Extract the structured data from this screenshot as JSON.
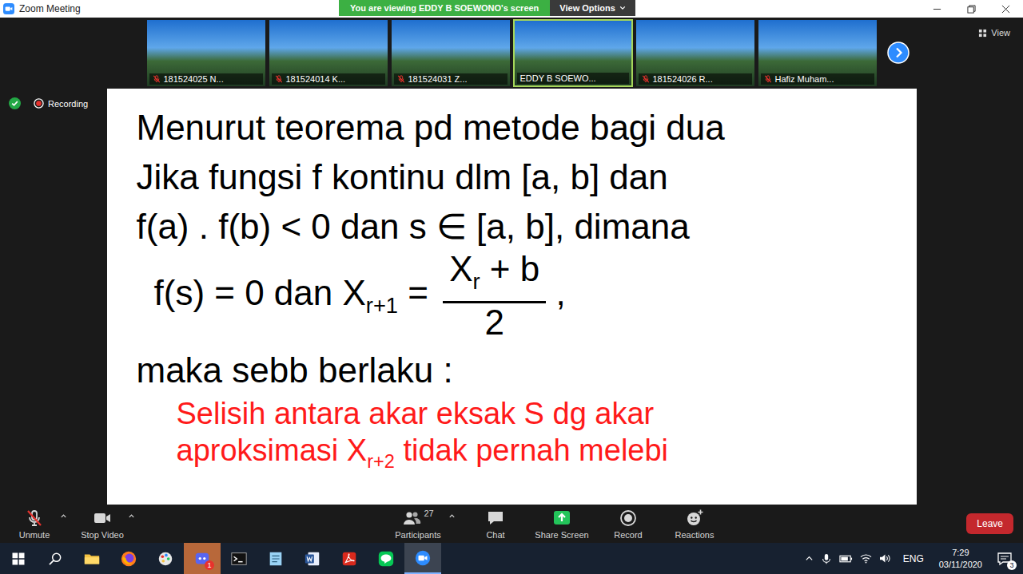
{
  "window": {
    "title": "Zoom Meeting"
  },
  "banner": {
    "text": "You are viewing EDDY B SOEWONO's screen",
    "options": "View Options"
  },
  "view": {
    "label": "View"
  },
  "recording": {
    "label": "Recording"
  },
  "thumbnails": [
    {
      "name": "181524025 N...",
      "muted": true,
      "selected": false
    },
    {
      "name": "181524014 K...",
      "muted": true,
      "selected": false
    },
    {
      "name": "181524031 Z...",
      "muted": true,
      "selected": false
    },
    {
      "name": "EDDY B SOEWO...",
      "muted": false,
      "selected": true
    },
    {
      "name": "181524026 R...",
      "muted": true,
      "selected": false
    },
    {
      "name": "Hafiz Muham...",
      "muted": true,
      "selected": false
    }
  ],
  "whiteboard": {
    "lines": [
      {
        "kind": "text",
        "color": "#000000",
        "parts": [
          {
            "text": "Menurut teorema pd metode bagi dua",
            "sub": false
          }
        ],
        "fraction": {
          "numerator": [],
          "denominator": ""
        },
        "after": ""
      },
      {
        "kind": "text",
        "color": "#000000",
        "parts": [
          {
            "text": "Jika fungsi f kontinu dlm [a, b] dan",
            "sub": false
          }
        ],
        "fraction": {
          "numerator": [],
          "denominator": ""
        },
        "after": ""
      },
      {
        "kind": "text",
        "color": "#000000",
        "parts": [
          {
            "text": "f(a) . f(b) < 0 dan s ∈ [a, b], dimana",
            "sub": false
          }
        ],
        "fraction": {
          "numerator": [],
          "denominator": ""
        },
        "after": ""
      },
      {
        "kind": "formula",
        "color": "#000000",
        "parts": [
          {
            "text": "f(s) = 0 dan X",
            "sub": false
          },
          {
            "text": "r+1",
            "sub": true
          },
          {
            "text": " = ",
            "sub": false
          }
        ],
        "fraction": {
          "numerator": [
            {
              "text": "X",
              "sub": false
            },
            {
              "text": "r",
              "sub": true
            },
            {
              "text": " + b",
              "sub": false
            }
          ],
          "denominator": "2"
        },
        "after": " ,"
      },
      {
        "kind": "text",
        "color": "#000000",
        "parts": [
          {
            "text": "maka sebb berlaku :",
            "sub": false
          }
        ],
        "fraction": {
          "numerator": [],
          "denominator": ""
        },
        "after": ""
      },
      {
        "kind": "annotation",
        "color": "#ff1a1a",
        "parts": [
          {
            "text": "Selisih antara akar eksak S dg akar",
            "sub": false
          }
        ],
        "fraction": {
          "numerator": [],
          "denominator": ""
        },
        "after": ""
      },
      {
        "kind": "annotation",
        "color": "#ff1a1a",
        "parts": [
          {
            "text": "aproksimasi X",
            "sub": false
          },
          {
            "text": "r+2",
            "sub": true
          },
          {
            "text": " tidak pernah melebi",
            "sub": false
          }
        ],
        "fraction": {
          "numerator": [],
          "denominator": ""
        },
        "after": ""
      }
    ]
  },
  "toolbar": {
    "left": [
      {
        "label": "Unmute",
        "kind": "mic",
        "count": "",
        "caret": true
      },
      {
        "label": "Stop Video",
        "kind": "video",
        "count": "",
        "caret": true
      }
    ],
    "center": [
      {
        "label": "Participants",
        "kind": "participants",
        "count": "27",
        "caret": true
      },
      {
        "label": "Chat",
        "kind": "chat",
        "count": "",
        "caret": false
      },
      {
        "label": "Share Screen",
        "kind": "share",
        "count": "",
        "caret": false
      },
      {
        "label": "Record",
        "kind": "record",
        "count": "",
        "caret": false
      },
      {
        "label": "Reactions",
        "kind": "reactions",
        "count": "",
        "caret": false
      }
    ],
    "leave": "Leave"
  },
  "taskbar": {
    "apps": [
      {
        "kind": "start",
        "active": false,
        "flashing": false,
        "badge": ""
      },
      {
        "kind": "search",
        "active": false,
        "flashing": false,
        "badge": ""
      },
      {
        "kind": "explorer",
        "active": false,
        "flashing": false,
        "badge": ""
      },
      {
        "kind": "firefox",
        "active": false,
        "flashing": false,
        "badge": ""
      },
      {
        "kind": "paint",
        "active": false,
        "flashing": false,
        "badge": ""
      },
      {
        "kind": "chatapp",
        "active": false,
        "flashing": true,
        "badge": "1"
      },
      {
        "kind": "terminal",
        "active": false,
        "flashing": false,
        "badge": ""
      },
      {
        "kind": "notepad",
        "active": false,
        "flashing": false,
        "badge": ""
      },
      {
        "kind": "word",
        "active": false,
        "flashing": false,
        "badge": ""
      },
      {
        "kind": "acrobat",
        "active": false,
        "flashing": false,
        "badge": ""
      },
      {
        "kind": "line",
        "active": false,
        "flashing": false,
        "badge": ""
      },
      {
        "kind": "zoom",
        "active": true,
        "flashing": false,
        "badge": ""
      }
    ],
    "tray": {
      "language": "ENG",
      "time": "7:29",
      "date": "03/11/2020",
      "notifications": "3"
    }
  }
}
